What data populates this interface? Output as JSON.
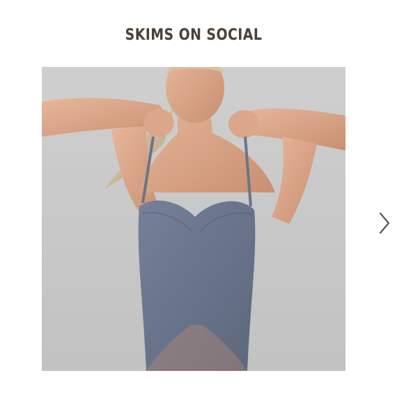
{
  "section": {
    "title": "SKIMS ON SOCIAL"
  },
  "carousel": {
    "slide_image": "model-in-slate-strapless-bodysuit",
    "next_icon": "chevron-right-icon"
  },
  "colors": {
    "title": "#4a4038",
    "background": "#ffffff",
    "photo_backdrop": "#c9c9c9",
    "bodysuit": "#6b7486",
    "arrow": "#555555"
  }
}
